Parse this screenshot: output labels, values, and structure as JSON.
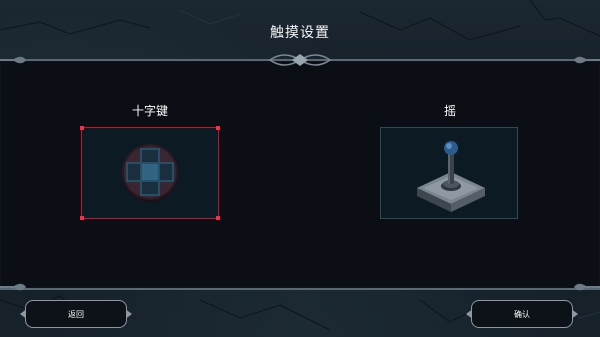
{
  "screen": {
    "title": "触摸设置"
  },
  "options": [
    {
      "label": "十字键",
      "selected": true,
      "icon": "dpad-icon"
    },
    {
      "label": "摇",
      "selected": false,
      "icon": "joystick-icon"
    }
  ],
  "buttons": {
    "back_label": "返回",
    "confirm_label": "确认"
  },
  "colors": {
    "selection": "#c4122c",
    "card_bg": "#0c1b23",
    "card_border": "#2f4a55",
    "panel_bg": "#0b0e14",
    "frame": "#586874"
  }
}
